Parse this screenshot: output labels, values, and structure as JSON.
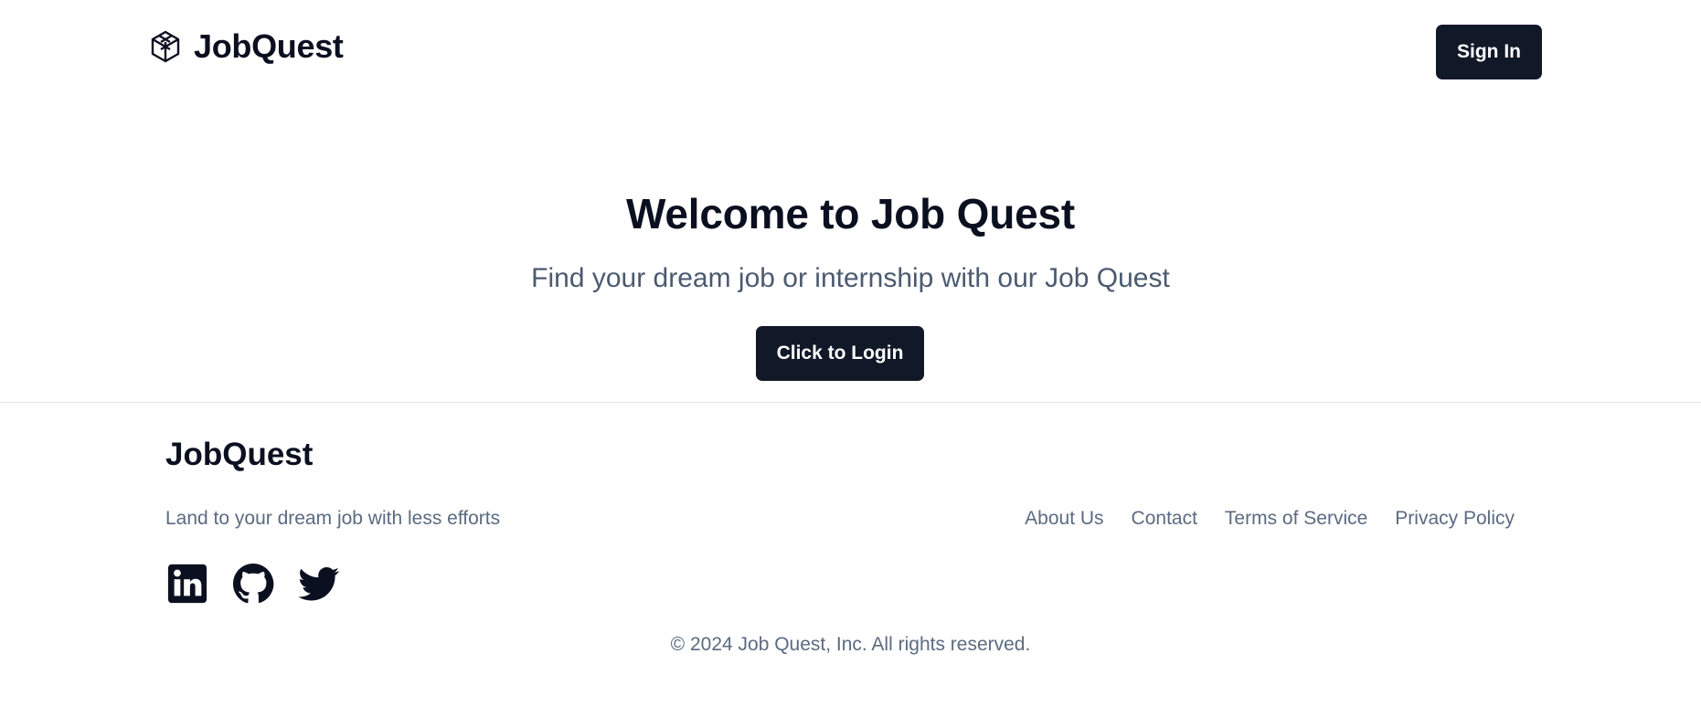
{
  "header": {
    "brand_name": "JobQuest",
    "signin_label": "Sign In"
  },
  "hero": {
    "title": "Welcome to Job Quest",
    "subtitle": "Find your dream job or internship with our Job Quest",
    "cta_label": "Click to Login"
  },
  "footer": {
    "brand_name": "JobQuest",
    "tagline": "Land to your dream job with less efforts",
    "links": [
      "About Us",
      "Contact",
      "Terms of Service",
      "Privacy Policy"
    ],
    "socials": [
      "linkedin-icon",
      "github-icon",
      "twitter-icon"
    ],
    "copyright": "© 2024 Job Quest, Inc. All rights reserved."
  },
  "colors": {
    "primary_button": "#111827",
    "text_dark": "#0b1020",
    "text_muted": "#5b6b80",
    "divider": "#e5e7eb"
  }
}
